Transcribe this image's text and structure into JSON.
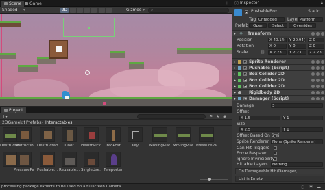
{
  "tabs": {
    "scene": "Scene",
    "game": "Game",
    "project": "Project",
    "inspector": "Inspector"
  },
  "scene_toolbar": {
    "shading": "Shaded",
    "mode_2d": "2D",
    "gizmos": "Gizmos",
    "search_placeholder": "All"
  },
  "project": {
    "breadcrumb": [
      "2DGamekit",
      "Prefabs",
      "Interactables"
    ],
    "assets": [
      "Destructib...",
      "Destructab...",
      "Door",
      "HealthPick...",
      "InfoPost",
      "Key",
      "MovingPlat...",
      "MovingPlat...",
      "PressurePad",
      "Pushable...",
      "Reusable...",
      "SingleUse...",
      "Teleporter"
    ],
    "slider_value": 0.3
  },
  "status": {
    "message": "processing package expects to be used on a fullscreen Camera."
  },
  "inspector": {
    "object_name": "PushableBox",
    "static_label": "Static",
    "tag_label": "Tag",
    "tag_value": "Untagged",
    "layer_label": "Layer",
    "layer_value": "Platform",
    "prefab_label": "Prefab",
    "prefab_open": "Open",
    "prefab_select": "Select",
    "prefab_overrides": "Overrides",
    "transform": {
      "title": "Transform",
      "position_label": "Position",
      "rotation_label": "Rotation",
      "scale_label": "Scale",
      "position": [
        "X 40.14(",
        "Y 20.94(",
        "Z 0"
      ],
      "rotation": [
        "X 0",
        "Y 0",
        "Z 0"
      ],
      "scale": [
        "X 2.23",
        "Y 2.23",
        "Z 2.23"
      ]
    },
    "components": [
      "Sprite Renderer",
      "Pushable (Script)",
      "Box Collider 2D",
      "Box Collider 2D",
      "Box Collider 2D",
      "Rigidbody 2D",
      "Damager (Script)"
    ],
    "damager": {
      "damage_label": "Damage",
      "damage_value": "3",
      "offset_label": "Offset",
      "offset_x": "X 1.5",
      "offset_y": "Y 1",
      "size_label": "Size",
      "size_x": "X 2.5",
      "size_y": "Y 1",
      "offset_sprite_label": "Offset Based On Spri",
      "sprite_renderer_label": "Sprite Renderer",
      "sprite_renderer_value": "None (Sprite Renderer)",
      "can_hit_label": "Can Hit Triggers",
      "force_respawn_label": "Force Respawn",
      "ignore_invincibility_label": "Ignore Invincibility",
      "hittable_layers_label": "Hittable Layers",
      "hittable_layers_value": "Nothing",
      "on_damageable_hit": "On Damageable Hit (Damager, Damageable)",
      "list_empty": "List is Empty"
    }
  }
}
